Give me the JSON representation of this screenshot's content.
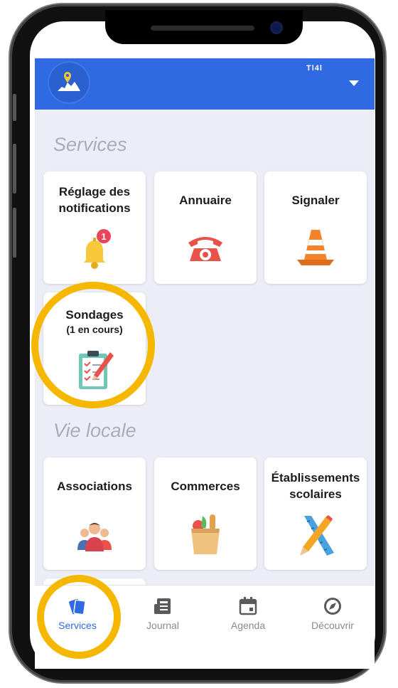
{
  "header": {
    "title": "Tl4l",
    "logo_icon": "village-logo-icon",
    "menu_icon": "caret-down-icon"
  },
  "sections": [
    {
      "title": "Services",
      "cards": [
        {
          "label": "Réglage des notifications",
          "sublabel": "",
          "icon": "bell-icon",
          "badge": "1"
        },
        {
          "label": "Annuaire",
          "sublabel": "",
          "icon": "telephone-icon",
          "badge": ""
        },
        {
          "label": "Signaler",
          "sublabel": "",
          "icon": "traffic-cone-icon",
          "badge": ""
        },
        {
          "label": "Sondages",
          "sublabel": "(1 en cours)",
          "icon": "clipboard-checklist-icon",
          "badge": ""
        }
      ]
    },
    {
      "title": "Vie locale",
      "cards": [
        {
          "label": "Associations",
          "sublabel": "",
          "icon": "people-group-icon",
          "badge": ""
        },
        {
          "label": "Commerces",
          "sublabel": "",
          "icon": "grocery-bag-icon",
          "badge": ""
        },
        {
          "label": "Établissements scolaires",
          "sublabel": "",
          "icon": "ruler-pencil-icon",
          "badge": ""
        }
      ]
    }
  ],
  "tabs": [
    {
      "label": "Services",
      "icon": "services-cards-icon",
      "active": true
    },
    {
      "label": "Journal",
      "icon": "newspaper-icon",
      "active": false
    },
    {
      "label": "Agenda",
      "icon": "calendar-icon",
      "active": false
    },
    {
      "label": "Découvrir",
      "icon": "compass-icon",
      "active": false
    }
  ],
  "colors": {
    "accent": "#2f6ae2",
    "highlight": "#f5b700",
    "background": "#ecedf6"
  }
}
